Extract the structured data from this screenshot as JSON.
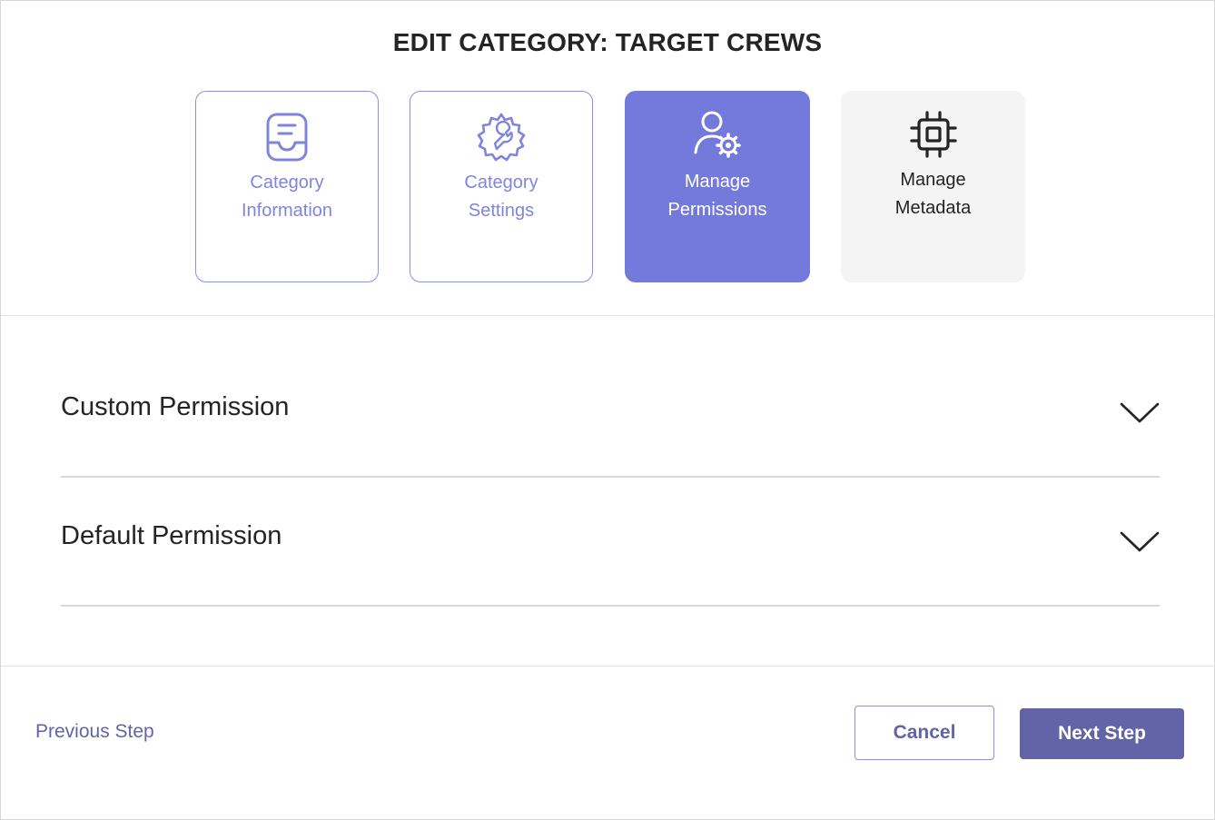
{
  "dialog": {
    "title": "EDIT CATEGORY: TARGET CREWS"
  },
  "steps": [
    {
      "line1": "Category",
      "line2": "Information",
      "state": "done",
      "icon": "inbox-document-icon"
    },
    {
      "line1": "Category",
      "line2": "Settings",
      "state": "done",
      "icon": "gear-wrench-icon"
    },
    {
      "line1": "Manage",
      "line2": "Permissions",
      "state": "active",
      "icon": "person-gear-icon"
    },
    {
      "line1": "Manage",
      "line2": "Metadata",
      "state": "pending",
      "icon": "chip-icon"
    }
  ],
  "sections": [
    {
      "label": "Custom Permission",
      "icon": "chevron-down-icon"
    },
    {
      "label": "Default Permission",
      "icon": "chevron-down-icon"
    }
  ],
  "footer": {
    "previous_label": "Previous Step",
    "cancel_label": "Cancel",
    "next_label": "Next Step"
  },
  "colors": {
    "accent": "#6264a7",
    "active_step": "#7479dc",
    "done_step_text": "#7f85dc",
    "pending_step_bg": "#f4f4f4"
  }
}
